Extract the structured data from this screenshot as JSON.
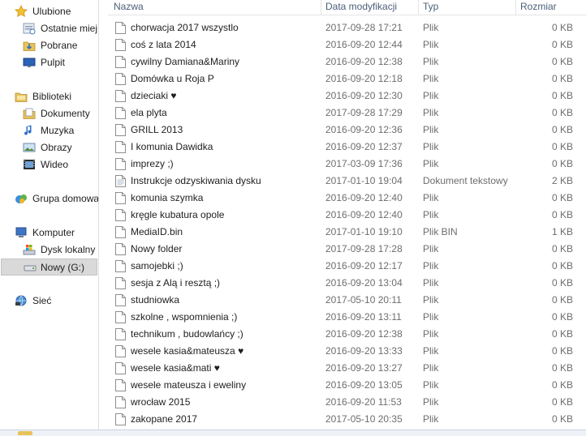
{
  "nav": {
    "items": [
      {
        "label": "Ulubione",
        "icon": "star-icon"
      },
      {
        "label": "Ostatnie miej",
        "icon": "recent-places-icon"
      },
      {
        "label": "Pobrane",
        "icon": "downloads-icon"
      },
      {
        "label": "Pulpit",
        "icon": "desktop-icon"
      },
      {
        "label": "Biblioteki",
        "icon": "libraries-icon"
      },
      {
        "label": "Dokumenty",
        "icon": "documents-icon"
      },
      {
        "label": "Muzyka",
        "icon": "music-icon"
      },
      {
        "label": "Obrazy",
        "icon": "pictures-icon"
      },
      {
        "label": "Wideo",
        "icon": "video-icon"
      },
      {
        "label": "Grupa domowa",
        "icon": "homegroup-icon"
      },
      {
        "label": "Komputer",
        "icon": "computer-icon"
      },
      {
        "label": "Dysk lokalny",
        "icon": "local-disk-icon"
      },
      {
        "label": "Nowy (G:)",
        "icon": "removable-drive-icon"
      },
      {
        "label": "Sieć",
        "icon": "network-icon"
      }
    ]
  },
  "columns": {
    "name": "Nazwa",
    "date": "Data modyfikacji",
    "type": "Typ",
    "size": "Rozmiar"
  },
  "files": [
    {
      "name": "chorwacja 2017 wszystlo",
      "date": "2017-09-28 17:21",
      "type": "Plik",
      "size": "0 KB",
      "icon": "file-icon"
    },
    {
      "name": "coś z lata 2014",
      "date": "2016-09-20 12:44",
      "type": "Plik",
      "size": "0 KB",
      "icon": "file-icon"
    },
    {
      "name": "cywilny Damiana&Mariny",
      "date": "2016-09-20 12:38",
      "type": "Plik",
      "size": "0 KB",
      "icon": "file-icon"
    },
    {
      "name": "Domówka u Roja P",
      "date": "2016-09-20 12:18",
      "type": "Plik",
      "size": "0 KB",
      "icon": "file-icon"
    },
    {
      "name": "dzieciaki ♥",
      "date": "2016-09-20 12:30",
      "type": "Plik",
      "size": "0 KB",
      "icon": "file-icon"
    },
    {
      "name": "ela plyta",
      "date": "2017-09-28 17:29",
      "type": "Plik",
      "size": "0 KB",
      "icon": "file-icon"
    },
    {
      "name": "GRILL 2013",
      "date": "2016-09-20 12:36",
      "type": "Plik",
      "size": "0 KB",
      "icon": "file-icon"
    },
    {
      "name": "I komunia Dawidka",
      "date": "2016-09-20 12:37",
      "type": "Plik",
      "size": "0 KB",
      "icon": "file-icon"
    },
    {
      "name": "imprezy ;)",
      "date": "2017-03-09 17:36",
      "type": "Plik",
      "size": "0 KB",
      "icon": "file-icon"
    },
    {
      "name": "Instrukcje odzyskiwania dysku",
      "date": "2017-01-10 19:04",
      "type": "Dokument tekstowy",
      "size": "2 KB",
      "icon": "text-document-icon"
    },
    {
      "name": "komunia szymka",
      "date": "2016-09-20 12:40",
      "type": "Plik",
      "size": "0 KB",
      "icon": "file-icon"
    },
    {
      "name": "kręgle kubatura opole",
      "date": "2016-09-20 12:40",
      "type": "Plik",
      "size": "0 KB",
      "icon": "file-icon"
    },
    {
      "name": "MediaID.bin",
      "date": "2017-01-10 19:10",
      "type": "Plik BIN",
      "size": "1 KB",
      "icon": "file-icon"
    },
    {
      "name": "Nowy folder",
      "date": "2017-09-28 17:28",
      "type": "Plik",
      "size": "0 KB",
      "icon": "file-icon"
    },
    {
      "name": "samojebki ;)",
      "date": "2016-09-20 12:17",
      "type": "Plik",
      "size": "0 KB",
      "icon": "file-icon"
    },
    {
      "name": "sesja z Alą i resztą ;)",
      "date": "2016-09-20 13:04",
      "type": "Plik",
      "size": "0 KB",
      "icon": "file-icon"
    },
    {
      "name": "studniowka",
      "date": "2017-05-10 20:11",
      "type": "Plik",
      "size": "0 KB",
      "icon": "file-icon"
    },
    {
      "name": "szkolne , wspomnienia ;)",
      "date": "2016-09-20 13:11",
      "type": "Plik",
      "size": "0 KB",
      "icon": "file-icon"
    },
    {
      "name": "technikum , budowlańcy ;)",
      "date": "2016-09-20 12:38",
      "type": "Plik",
      "size": "0 KB",
      "icon": "file-icon"
    },
    {
      "name": "wesele kasia&mateusza ♥",
      "date": "2016-09-20 13:33",
      "type": "Plik",
      "size": "0 KB",
      "icon": "file-icon"
    },
    {
      "name": "wesele kasia&mati ♥",
      "date": "2016-09-20 13:27",
      "type": "Plik",
      "size": "0 KB",
      "icon": "file-icon"
    },
    {
      "name": "wesele mateusza i eweliny",
      "date": "2016-09-20 13:05",
      "type": "Plik",
      "size": "0 KB",
      "icon": "file-icon"
    },
    {
      "name": "wrocław 2015",
      "date": "2016-09-20 11:53",
      "type": "Plik",
      "size": "0 KB",
      "icon": "file-icon"
    },
    {
      "name": "zakopane 2017",
      "date": "2017-05-10 20:35",
      "type": "Plik",
      "size": "0 KB",
      "icon": "file-icon"
    }
  ]
}
